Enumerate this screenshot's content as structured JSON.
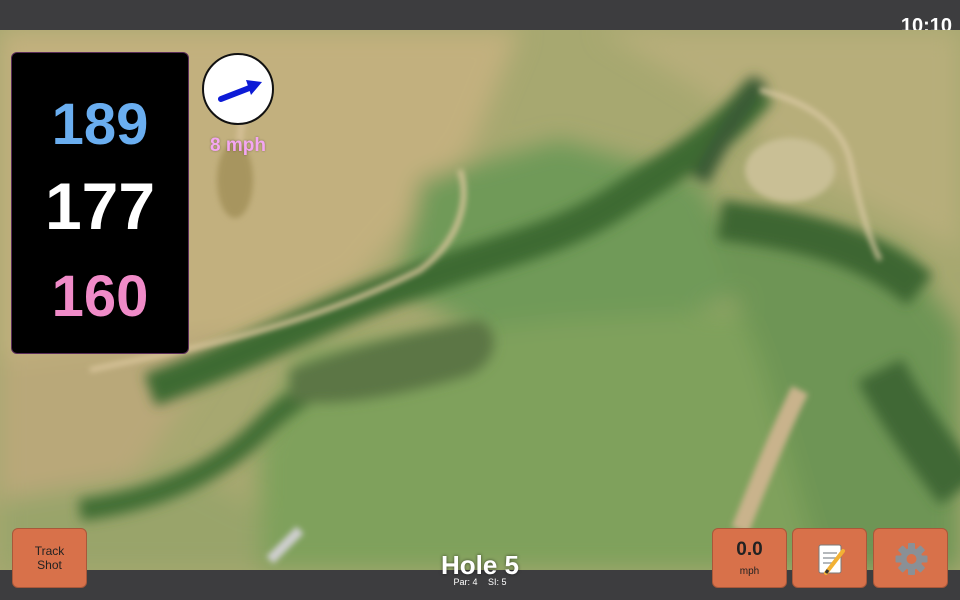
{
  "status_bar": {
    "time": "10:10"
  },
  "yardages": {
    "back": "189",
    "middle": "177",
    "front": "160",
    "back_color": "#6aaef0",
    "middle_color": "#ffffff",
    "front_color": "#f08bc8"
  },
  "wind": {
    "speed_label": "8 mph",
    "direction_icon": "arrow-icon",
    "arrow_color": "#0d1bd6",
    "label_color": "#f4a6f2"
  },
  "hole": {
    "title": "Hole 5",
    "par": "Par: 4",
    "stroke_index": "SI: 5"
  },
  "buttons": {
    "track_shot": "Track\nShot",
    "speed_value": "0.0",
    "speed_unit": "mph",
    "notes_icon": "notepad-icon",
    "settings_icon": "gear-icon",
    "color": "#d8714a"
  }
}
